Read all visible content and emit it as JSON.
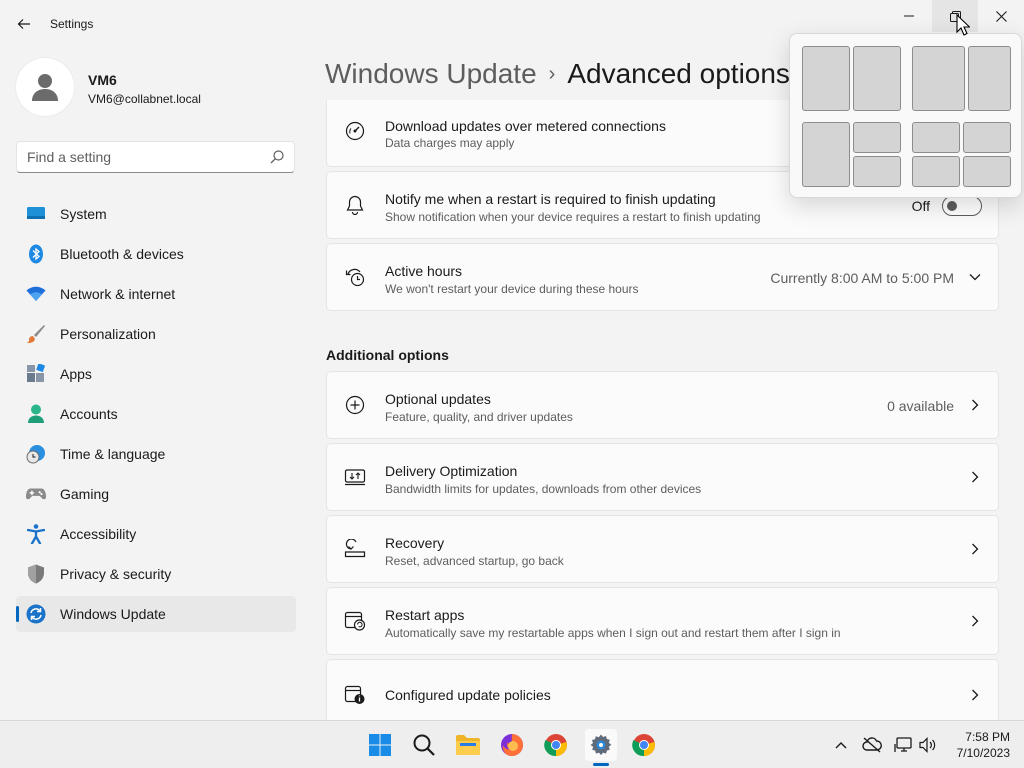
{
  "window": {
    "title": "Settings"
  },
  "profile": {
    "name": "VM6",
    "email": "VM6@collabnet.local"
  },
  "search": {
    "placeholder": "Find a setting"
  },
  "sidebar": {
    "items": [
      {
        "label": "System",
        "icon": "system-icon"
      },
      {
        "label": "Bluetooth & devices",
        "icon": "bluetooth-icon"
      },
      {
        "label": "Network & internet",
        "icon": "wifi-icon"
      },
      {
        "label": "Personalization",
        "icon": "brush-icon"
      },
      {
        "label": "Apps",
        "icon": "apps-icon"
      },
      {
        "label": "Accounts",
        "icon": "person-icon"
      },
      {
        "label": "Time & language",
        "icon": "globe-clock-icon"
      },
      {
        "label": "Gaming",
        "icon": "gamepad-icon"
      },
      {
        "label": "Accessibility",
        "icon": "accessibility-icon"
      },
      {
        "label": "Privacy & security",
        "icon": "shield-icon"
      },
      {
        "label": "Windows Update",
        "icon": "update-icon",
        "active": true
      }
    ]
  },
  "header": {
    "crumb": "Windows Update",
    "separator": "›",
    "current": "Advanced options"
  },
  "cards": {
    "metered": {
      "title": "Download updates over metered connections",
      "subtitle": "Data charges may apply"
    },
    "restart_notify": {
      "title": "Notify me when a restart is required to finish updating",
      "subtitle": "Show notification when your device requires a restart to finish updating",
      "toggle_label": "Off",
      "toggle_on": false
    },
    "active_hours": {
      "title": "Active hours",
      "subtitle": "We won't restart your device during these hours",
      "value": "Currently 8:00 AM to 5:00 PM"
    }
  },
  "additional": {
    "title": "Additional options",
    "items": [
      {
        "title": "Optional updates",
        "subtitle": "Feature, quality, and driver updates",
        "value": "0 available"
      },
      {
        "title": "Delivery Optimization",
        "subtitle": "Bandwidth limits for updates, downloads from other devices",
        "value": ""
      },
      {
        "title": "Recovery",
        "subtitle": "Reset, advanced startup, go back",
        "value": ""
      },
      {
        "title": "Restart apps",
        "subtitle": "Automatically save my restartable apps when I sign out and restart them after I sign in",
        "value": ""
      },
      {
        "title": "Configured update policies",
        "subtitle": "",
        "value": ""
      }
    ]
  },
  "taskbar": {
    "time": "7:58 PM",
    "date": "7/10/2023"
  },
  "colors": {
    "accent": "#0067c0"
  }
}
